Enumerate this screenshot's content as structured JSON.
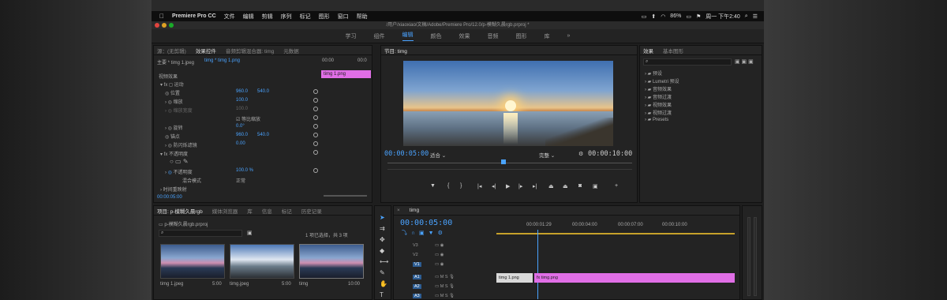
{
  "menubar": {
    "app_name": "Premiere Pro CC",
    "items": [
      "文件",
      "编辑",
      "剪辑",
      "序列",
      "标记",
      "图形",
      "窗口",
      "帮助"
    ],
    "battery": "86%",
    "clock": "周一 下午2:40"
  },
  "titlebar": {
    "path": "/用户/xiaoxiao/文稿/Adobe/Premiere Pro/12.0/p-模糊久晨rgb.prproj *"
  },
  "workspaces": [
    "学习",
    "组件",
    "编辑",
    "颜色",
    "效果",
    "音频",
    "图形",
    "库"
  ],
  "workspace_active": 2,
  "effect_controls": {
    "tabs": [
      "源：(无剪辑)",
      "效果控件",
      "音频剪辑混合器: timg",
      "元数据"
    ],
    "master_label": "主要 * timg 1.jpeg",
    "clip_label": "timg * timg 1.png",
    "header_time": "00:00",
    "header_time2": "00:0",
    "clip_bar": "timg 1.png",
    "section_video": "视频效果",
    "fx_motion": "运动",
    "position_label": "位置",
    "position_x": "960.0",
    "position_y": "540.0",
    "scale_label": "缩放",
    "scale_val": "100.0",
    "scale_width_label": "缩放宽度",
    "scale_width_val": "100.0",
    "uniform_label": "等比缩放",
    "rotation_label": "旋转",
    "rotation_val": "0.0°",
    "anchor_label": "锚点",
    "anchor_x": "960.0",
    "anchor_y": "540.0",
    "flicker_label": "防闪烁滤镜",
    "flicker_val": "0.00",
    "fx_opacity": "不透明度",
    "opacity_label": "不透明度",
    "opacity_val": "100.0 %",
    "blend_label": "混合模式",
    "blend_val": "正常",
    "time_remap": "时间重映射",
    "footer_time": "00:00:05:00"
  },
  "program": {
    "tab": "节目: timg",
    "timecode": "00:00:05:00",
    "fit": "适合",
    "quality": "完整",
    "duration": "00:00:10:00"
  },
  "effects": {
    "tabs": [
      "效果",
      "基本图形"
    ],
    "items": [
      "预设",
      "Lumetri 预设",
      "音频效果",
      "音频过渡",
      "视频效果",
      "视频过渡",
      "Presets"
    ]
  },
  "project": {
    "tabs": [
      "项目: p-模糊久晨rgb",
      "媒体浏览器",
      "库",
      "信息",
      "标记",
      "历史记录"
    ],
    "file": "p-模糊久晨rgb.prproj",
    "selection": "1 项已选择，共 3 项",
    "items": [
      {
        "name": "timg 1.jpeg",
        "dur": "5:00"
      },
      {
        "name": "timg.jpeg",
        "dur": "5:00"
      },
      {
        "name": "timg",
        "dur": "10:00"
      }
    ]
  },
  "timeline": {
    "tab": "timg",
    "timecode": "00:00:05:00",
    "ruler": [
      "00:00:01:29",
      "00:00:04:00",
      "00:00:07:00",
      "00:00:10:00"
    ],
    "tracks": [
      "V3",
      "V2",
      "V1",
      "A1",
      "A2",
      "A3"
    ],
    "clip_v1a": "timg 1.png",
    "clip_v1b": "fx timg.png"
  },
  "colors": {
    "accent": "#4aa3ff",
    "clip_pink": "#d05fd6",
    "clip_label": "#e06ee6"
  }
}
